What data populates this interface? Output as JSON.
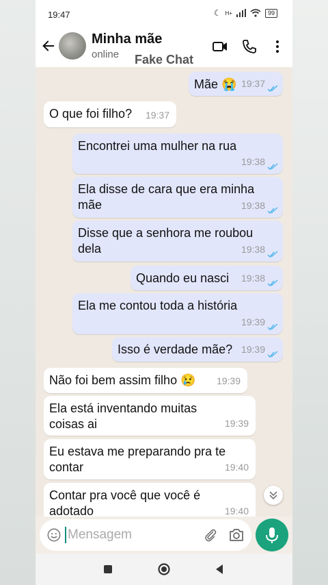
{
  "status": {
    "time": "19:47",
    "network": "H+",
    "battery": "99"
  },
  "header": {
    "contact_name": "Minha mãe",
    "contact_status": "online",
    "watermark": "Fake Chat"
  },
  "messages": [
    {
      "dir": "out",
      "text": "Mãe 😭",
      "time": "19:37",
      "read": true
    },
    {
      "dir": "in",
      "text": "O que foi filho?",
      "time": "19:37"
    },
    {
      "dir": "out",
      "text": "Encontrei uma mulher na rua",
      "time": "19:38",
      "read": true
    },
    {
      "dir": "out",
      "text": "Ela disse de cara que era minha\nmãe",
      "time": "19:38",
      "read": true
    },
    {
      "dir": "out",
      "text": "Disse que a senhora me roubou\ndela",
      "time": "19:38",
      "read": true
    },
    {
      "dir": "out",
      "text": "Quando eu nasci",
      "time": "19:38",
      "read": true
    },
    {
      "dir": "out",
      "text": "Ela me contou toda a história",
      "time": "19:39",
      "read": true
    },
    {
      "dir": "out",
      "text": "Isso é verdade mãe?",
      "time": "19:39",
      "read": true
    },
    {
      "dir": "in",
      "text": "Não foi bem assim filho 😢",
      "time": "19:39"
    },
    {
      "dir": "in",
      "text": "Ela está inventando muitas\ncoisas ai",
      "time": "19:39"
    },
    {
      "dir": "in",
      "text": "Eu estava me preparando pra te\ncontar",
      "time": "19:40"
    },
    {
      "dir": "in",
      "text": "Contar pra você que você é\nadotado",
      "time": "19:40"
    }
  ],
  "composer": {
    "placeholder": "Mensagem"
  },
  "colors": {
    "outgoing_bubble": "#e2e6fb",
    "incoming_bubble": "#ffffff",
    "read_ticks": "#4fb6ec",
    "accent": "#1aa37d"
  }
}
